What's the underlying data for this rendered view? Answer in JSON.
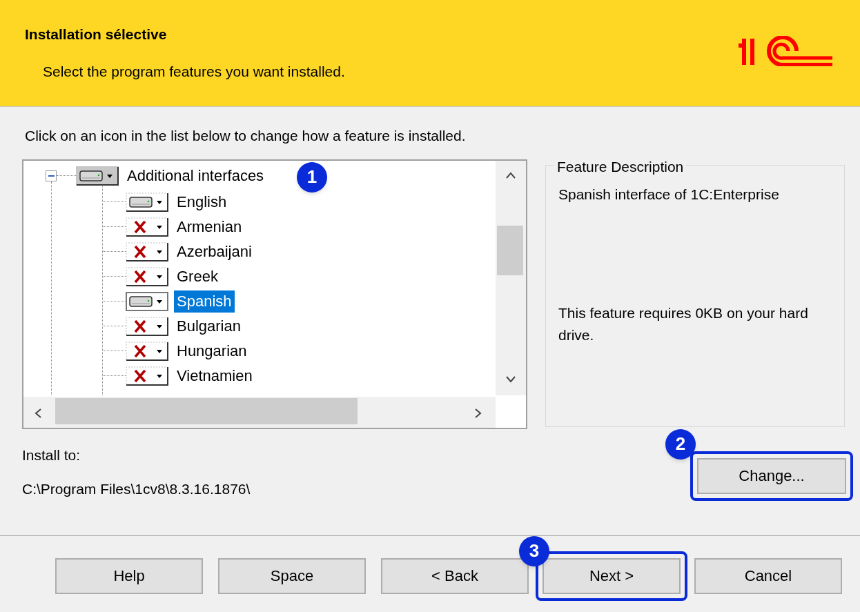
{
  "header": {
    "title": "Installation sélective",
    "subtitle": "Select the program features you want installed."
  },
  "instruction": "Click on an icon in the list below to change how a feature is installed.",
  "tree": {
    "label": "Additional interfaces",
    "kind": "installed",
    "expanded": true,
    "callout": "1",
    "selected": false,
    "children": [
      {
        "label": "English",
        "kind": "installed",
        "selected": false
      },
      {
        "label": "Armenian",
        "kind": "excluded",
        "selected": false
      },
      {
        "label": "Azerbaijani",
        "kind": "excluded",
        "selected": false
      },
      {
        "label": "Greek",
        "kind": "excluded",
        "selected": false
      },
      {
        "label": "Spanish",
        "kind": "installed",
        "selected": true
      },
      {
        "label": "Bulgarian",
        "kind": "excluded",
        "selected": false
      },
      {
        "label": "Hungarian",
        "kind": "excluded",
        "selected": false
      },
      {
        "label": "Vietnamien",
        "kind": "excluded",
        "selected": false
      }
    ]
  },
  "feature_description": {
    "title": "Feature Description",
    "text": "Spanish interface of 1C:Enterprise",
    "requirement": "This feature requires 0KB on your hard drive."
  },
  "install_to": {
    "label": "Install to:",
    "path": "C:\\Program Files\\1cv8\\8.3.16.1876\\",
    "button": {
      "label": "Change...",
      "callout": "2"
    }
  },
  "buttons": [
    {
      "label": "Help"
    },
    {
      "label": "Space"
    },
    {
      "label": "< Back"
    },
    {
      "label": "Next >",
      "callout": "3"
    },
    {
      "label": "Cancel"
    }
  ]
}
